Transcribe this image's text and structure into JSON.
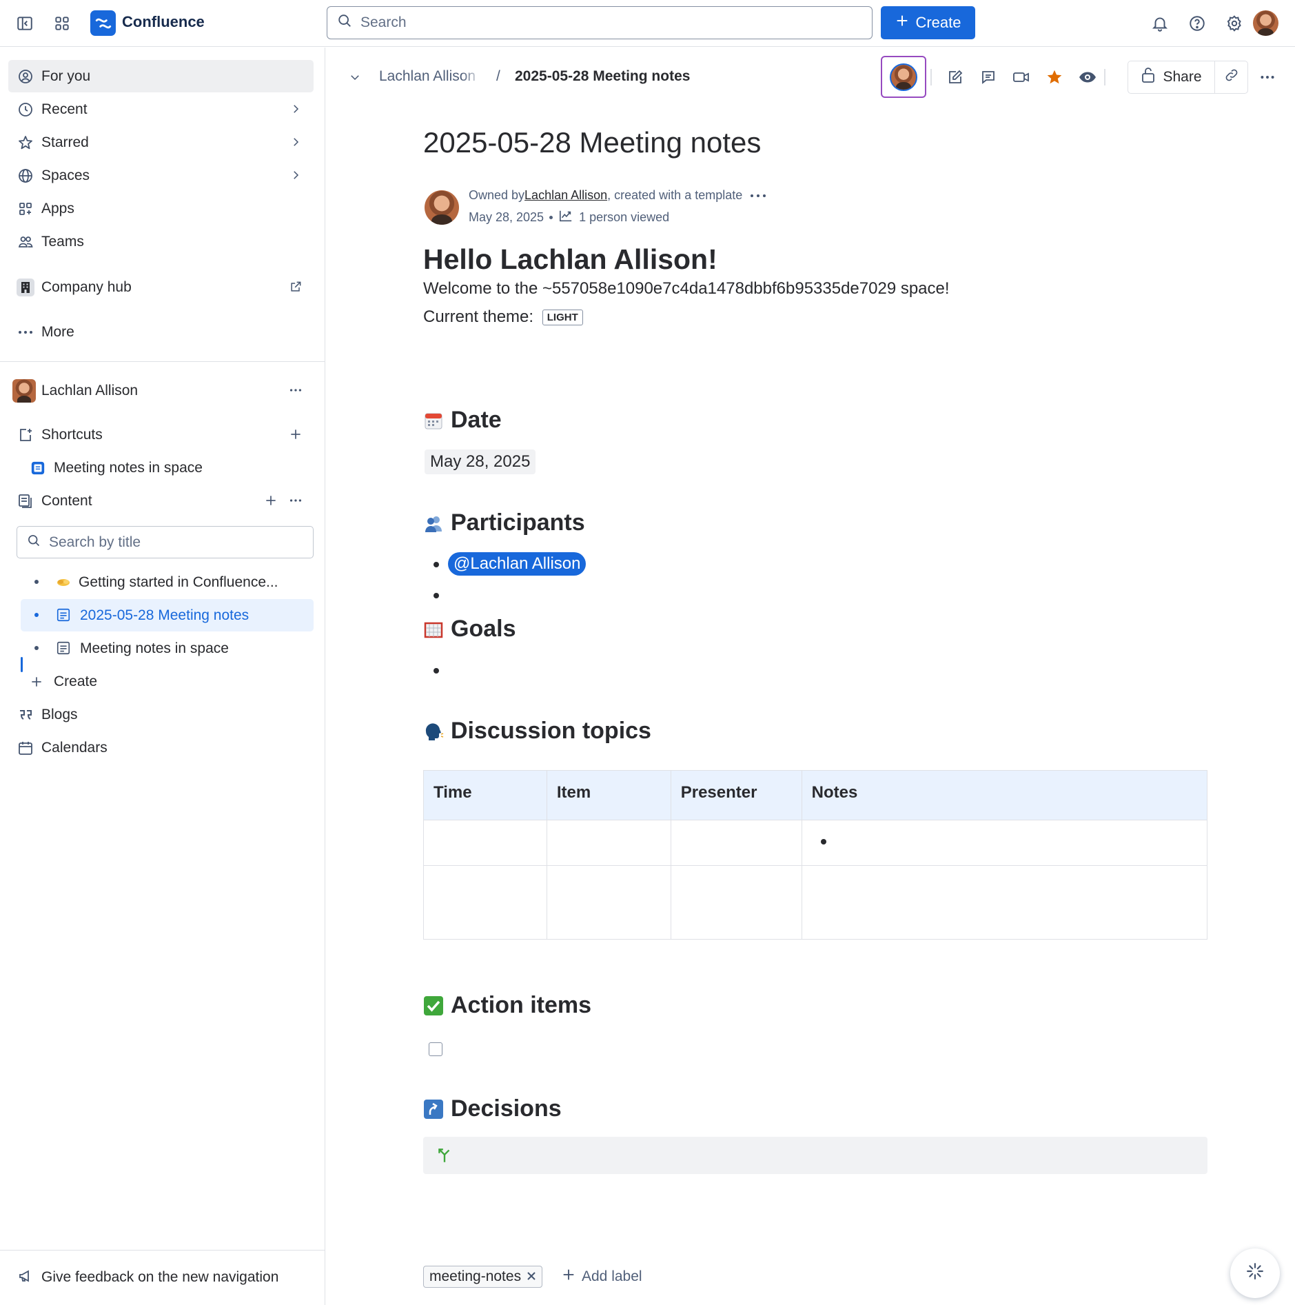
{
  "topbar": {
    "app_name": "Confluence",
    "search_placeholder": "Search",
    "create_label": "Create"
  },
  "sidebar": {
    "nav": [
      {
        "label": "For you",
        "icon": "user-circle-icon"
      },
      {
        "label": "Recent",
        "icon": "clock-icon"
      },
      {
        "label": "Starred",
        "icon": "star-icon"
      },
      {
        "label": "Spaces",
        "icon": "globe-icon"
      },
      {
        "label": "Apps",
        "icon": "apps-icon"
      },
      {
        "label": "Teams",
        "icon": "people-icon"
      }
    ],
    "company_hub": "Company hub",
    "more": "More",
    "space_name": "Lachlan Allison",
    "shortcuts": "Shortcuts",
    "shortcut_item": "Meeting notes in space",
    "content": "Content",
    "search_placeholder": "Search by title",
    "tree": [
      {
        "label": "Getting started in Confluence...",
        "icon": "handshake-emoji"
      },
      {
        "label": "2025-05-28 Meeting notes",
        "icon": "page-icon"
      },
      {
        "label": "Meeting notes in space",
        "icon": "page-icon"
      }
    ],
    "create": "Create",
    "blogs": "Blogs",
    "calendars": "Calendars",
    "feedback": "Give feedback on the new navigation"
  },
  "header": {
    "breadcrumb_space": "Lachlan Allison",
    "breadcrumb_sep": "/",
    "breadcrumb_page": "2025-05-28 Meeting notes",
    "share_label": "Share",
    "starred_color": "#e06c00"
  },
  "page": {
    "title": "2025-05-28 Meeting notes",
    "byline": {
      "owned_by": "Owned by ",
      "owner": "Lachlan Allison",
      "created_with": ", created with a template",
      "date": "May 28, 2025",
      "views": "1 person viewed"
    },
    "hello": "Hello Lachlan Allison!",
    "welcome": "Welcome to the ~557058e1090e7c4da1478dbbf6b95335de7029 space!",
    "theme_label": "Current theme:",
    "theme_value": "LIGHT",
    "sections": {
      "date": "Date",
      "participants": "Participants",
      "goals": "Goals",
      "discussion": "Discussion topics",
      "actions": "Action items",
      "decisions": "Decisions"
    },
    "date_value": "May 28, 2025",
    "mention": "@Lachlan Allison",
    "table": {
      "headers": [
        "Time",
        "Item",
        "Presenter",
        "Notes"
      ]
    },
    "label": "meeting-notes",
    "add_label": "Add label"
  },
  "colors": {
    "brand": "#1868db",
    "highlight_border": "#964ac0"
  }
}
